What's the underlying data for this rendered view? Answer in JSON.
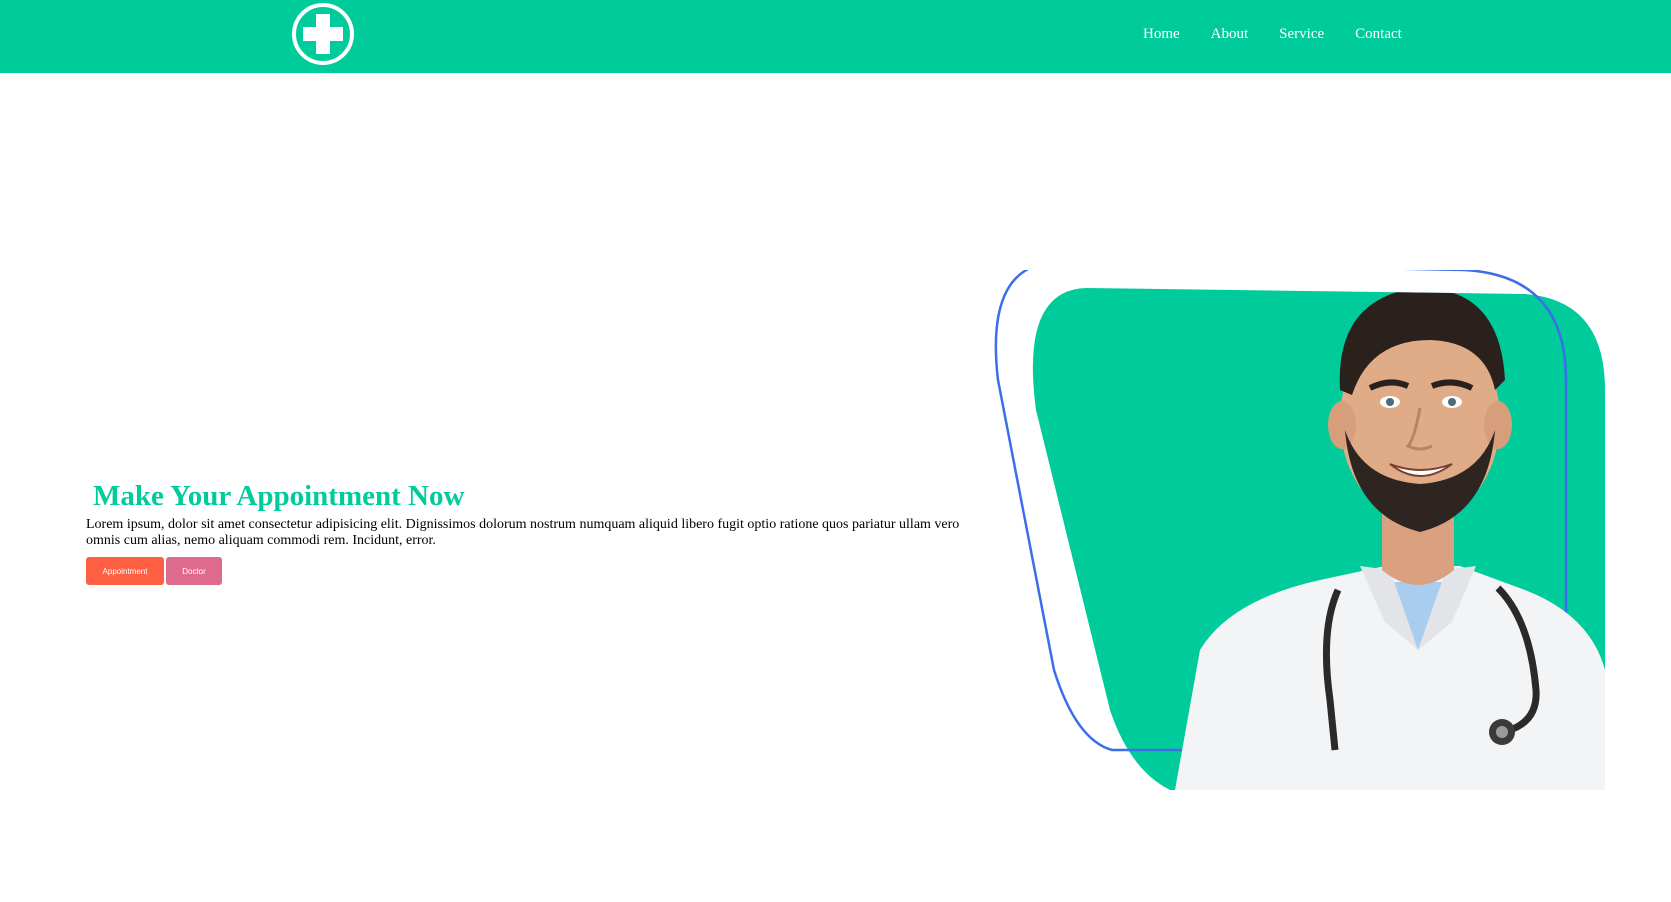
{
  "nav": {
    "logo_icon": "medical-cross-icon",
    "links": [
      {
        "label": "Home"
      },
      {
        "label": "About"
      },
      {
        "label": "Service"
      },
      {
        "label": "Contact"
      }
    ]
  },
  "hero": {
    "title": "Make Your Appointment Now",
    "description": "Lorem ipsum, dolor sit amet consectetur adipisicing elit. Dignissimos dolorum nostrum numquam aliquid libero fugit optio ratione quos pariatur ullam vero omnis cum alias, nemo aliquam commodi rem. Incidunt, error.",
    "buttons": {
      "appointment": "Appointment",
      "doctor": "Doctor"
    }
  },
  "colors": {
    "brand": "#00cc9b",
    "outline": "#3b6ee8",
    "appointment_button": "#ff6044",
    "doctor_button": "#de6b8d"
  }
}
